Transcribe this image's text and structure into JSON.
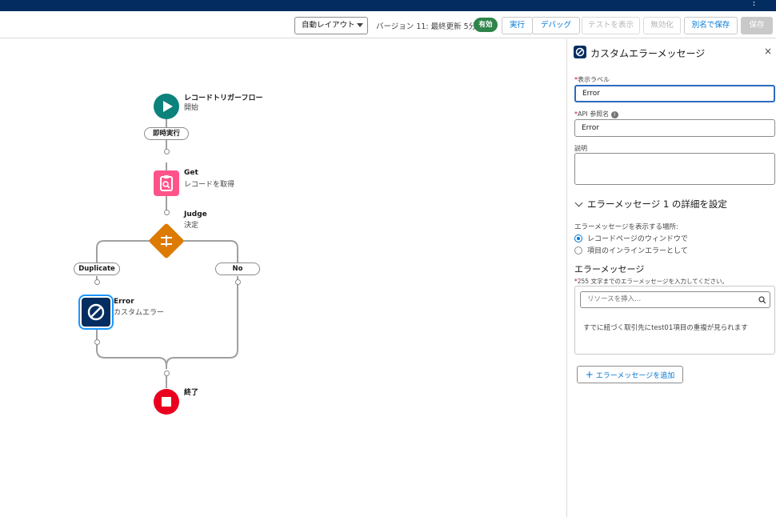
{
  "toolbar": {
    "layout_select": "自動レイアウト",
    "version_text": "バージョン 11: 最終更新 5分前",
    "status_badge": "有効",
    "run_label": "実行",
    "debug_label": "デバッグ",
    "test_label": "テストを表示",
    "deactivate_label": "無効化",
    "save_as_label": "別名で保存",
    "save_label": "保存"
  },
  "flow": {
    "start_title": "レコードトリガーフロー",
    "start_sub": "開始",
    "run_immediately": "即時実行",
    "get_title": "Get",
    "get_sub": "レコードを取得",
    "judge_title": "Judge",
    "judge_sub": "決定",
    "branch_duplicate": "Duplicate",
    "branch_no": "No",
    "error_title": "Error",
    "error_sub": "カスタムエラー",
    "end_title": "終了"
  },
  "panel": {
    "title": "カスタムエラーメッセージ",
    "close": "×",
    "label_field": "表示ラベル",
    "label_value": "Error",
    "api_field": "API 参照名",
    "api_value": "Error",
    "desc_field": "説明",
    "section_title": "エラーメッセージ 1 の詳細を設定",
    "location_label": "エラーメッセージを表示する場所:",
    "radio_window": "レコードページのウィンドウで",
    "radio_inline": "項目のインラインエラーとして",
    "msg_heading": "エラーメッセージ",
    "msg_hint": "255 文字までのエラーメッセージを入力してください。",
    "resource_placeholder": "リソースを挿入...",
    "msg_text": "すでに紐づく取引先にtest01項目の重複が見られます",
    "add_button": "エラーメッセージを追加"
  },
  "colors": {
    "start": "#0b827c",
    "get": "#ff538a",
    "decision": "#dd7a01",
    "error": "#032d60",
    "end": "#ea001e"
  }
}
